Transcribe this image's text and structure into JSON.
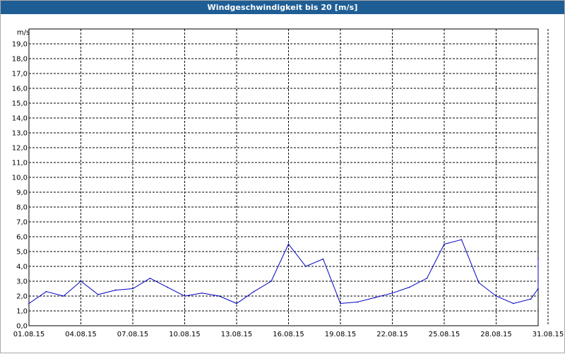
{
  "window": {
    "title": "Windgeschwindigkeit bis 20 [m/s]"
  },
  "colors": {
    "title_bar": "#1f5e95",
    "series": "#0000c0",
    "grid": "#000000"
  },
  "chart_data": {
    "type": "line",
    "title": "Windgeschwindigkeit bis 20 [m/s]",
    "ylabel": "m/s",
    "xlabel": "",
    "ylim": [
      0,
      20
    ],
    "xlim": [
      "01.08.15",
      "01.09.15"
    ],
    "grid": true,
    "legend": "none",
    "y_ticks": [
      "0,0",
      "1,0",
      "2,0",
      "3,0",
      "4,0",
      "5,0",
      "6,0",
      "7,0",
      "8,0",
      "9,0",
      "10,0",
      "11,0",
      "12,0",
      "13,0",
      "14,0",
      "15,0",
      "16,0",
      "17,0",
      "18,0",
      "19,0"
    ],
    "x_ticks": [
      "01.08.15",
      "04.08.15",
      "07.08.15",
      "10.08.15",
      "13.08.15",
      "16.08.15",
      "19.08.15",
      "22.08.15",
      "25.08.15",
      "28.08.15",
      "31.08.15"
    ],
    "series": [
      {
        "x": [
          "01.08.15",
          "02.08.15",
          "03.08.15",
          "04.08.15",
          "05.08.15",
          "06.08.15",
          "07.08.15",
          "08.08.15",
          "09.08.15",
          "10.08.15",
          "11.08.15",
          "12.08.15",
          "13.08.15",
          "14.08.15",
          "15.08.15",
          "16.08.15",
          "17.08.15",
          "18.08.15",
          "19.08.15",
          "20.08.15",
          "21.08.15",
          "22.08.15",
          "23.08.15",
          "24.08.15",
          "25.08.15",
          "26.08.15",
          "27.08.15",
          "28.08.15",
          "29.08.15",
          "30.08.15",
          "31.08.15",
          "01.09.15"
        ],
        "values": [
          1.5,
          2.3,
          2.0,
          3.0,
          2.1,
          2.4,
          2.5,
          3.2,
          2.6,
          2.0,
          2.2,
          2.0,
          1.5,
          2.3,
          3.0,
          5.5,
          4.0,
          4.5,
          1.5,
          1.6,
          1.9,
          2.2,
          2.6,
          3.2,
          5.5,
          5.8,
          2.9,
          2.0,
          1.5,
          1.8,
          2.5,
          4.5
        ]
      }
    ]
  }
}
